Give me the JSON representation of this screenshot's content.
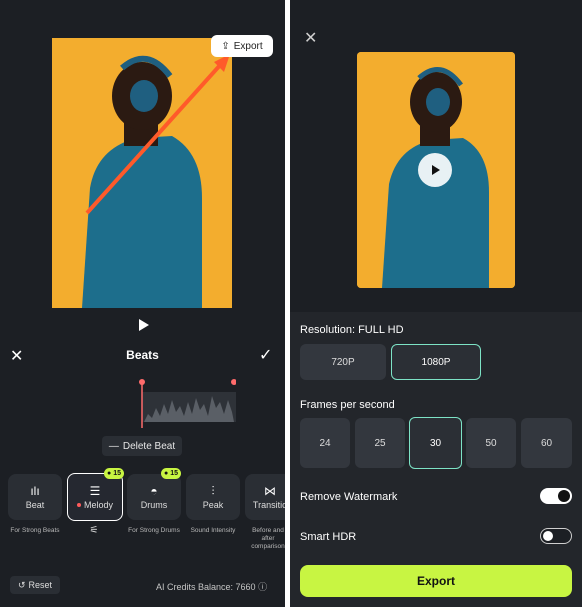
{
  "left": {
    "export_chip": "Export",
    "beats_title": "Beats",
    "delete_beat": "Delete Beat",
    "tools": [
      {
        "label": "Beat",
        "sub": "For Strong Beats",
        "glyph": "ılı"
      },
      {
        "label": "Melody",
        "sub": "",
        "glyph": "☰",
        "badge": "15",
        "selected": true
      },
      {
        "label": "Drums",
        "sub": "For Strong Drums",
        "glyph": "◓",
        "badge": "15"
      },
      {
        "label": "Peak",
        "sub": "Sound Intensity",
        "glyph": "⫶"
      },
      {
        "label": "Transitio",
        "sub": "Before and after comparison",
        "glyph": "⋈"
      }
    ],
    "reset": "Reset",
    "credits": "AI Credits Balance: 7660"
  },
  "right": {
    "resolution_label": "Resolution: FULL HD",
    "resolutions": [
      "720P",
      "1080P"
    ],
    "fps_label": "Frames per second",
    "fps": [
      "24",
      "25",
      "30",
      "50",
      "60"
    ],
    "remove_watermark": "Remove Watermark",
    "smart_hdr": "Smart HDR",
    "export": "Export"
  },
  "colors": {
    "accent": "#c8f542",
    "selected_border": "#7de3c6",
    "photo_bg": "#f3ad2e",
    "arrow": "#ff5a2a"
  }
}
